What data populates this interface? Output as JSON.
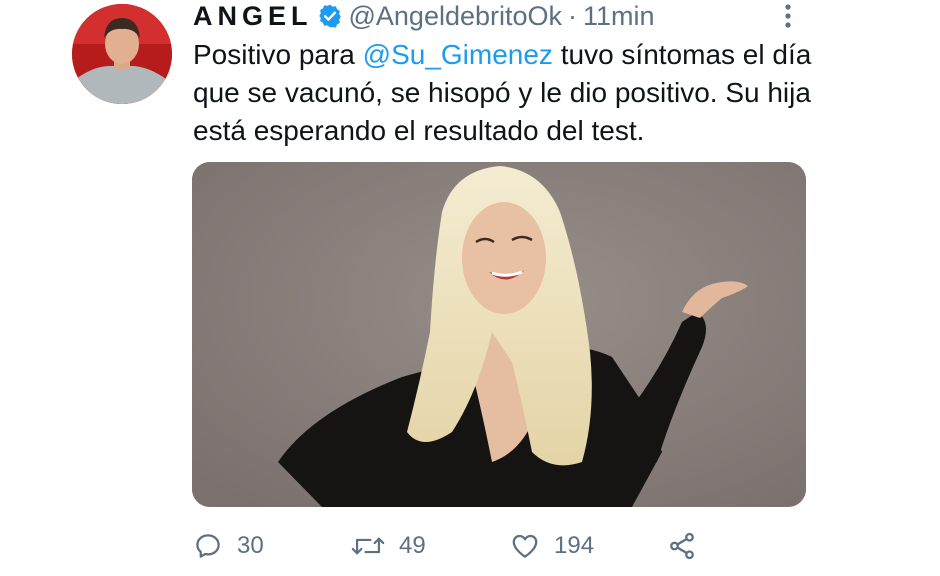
{
  "tweet": {
    "author": {
      "display_name": "ANGEL",
      "handle": "@AngeldebritoOk",
      "verified": true,
      "avatar_icon": "user-avatar"
    },
    "separator": "·",
    "time": "11min",
    "text": {
      "part1": "Positivo para ",
      "mention": "@Su_Gimenez",
      "part2": " tuvo síntomas el día que se vacunó, se hisopó y le dio positivo. Su hija está esperando el resultado del test."
    },
    "media": {
      "type": "photo"
    },
    "actions": {
      "reply_count": "30",
      "retweet_count": "49",
      "like_count": "194"
    }
  },
  "colors": {
    "text": "#0f1419",
    "secondary": "#5b7083",
    "link": "#1d9bf0",
    "verified": "#1d9bf0",
    "media_background": "#867c79"
  }
}
